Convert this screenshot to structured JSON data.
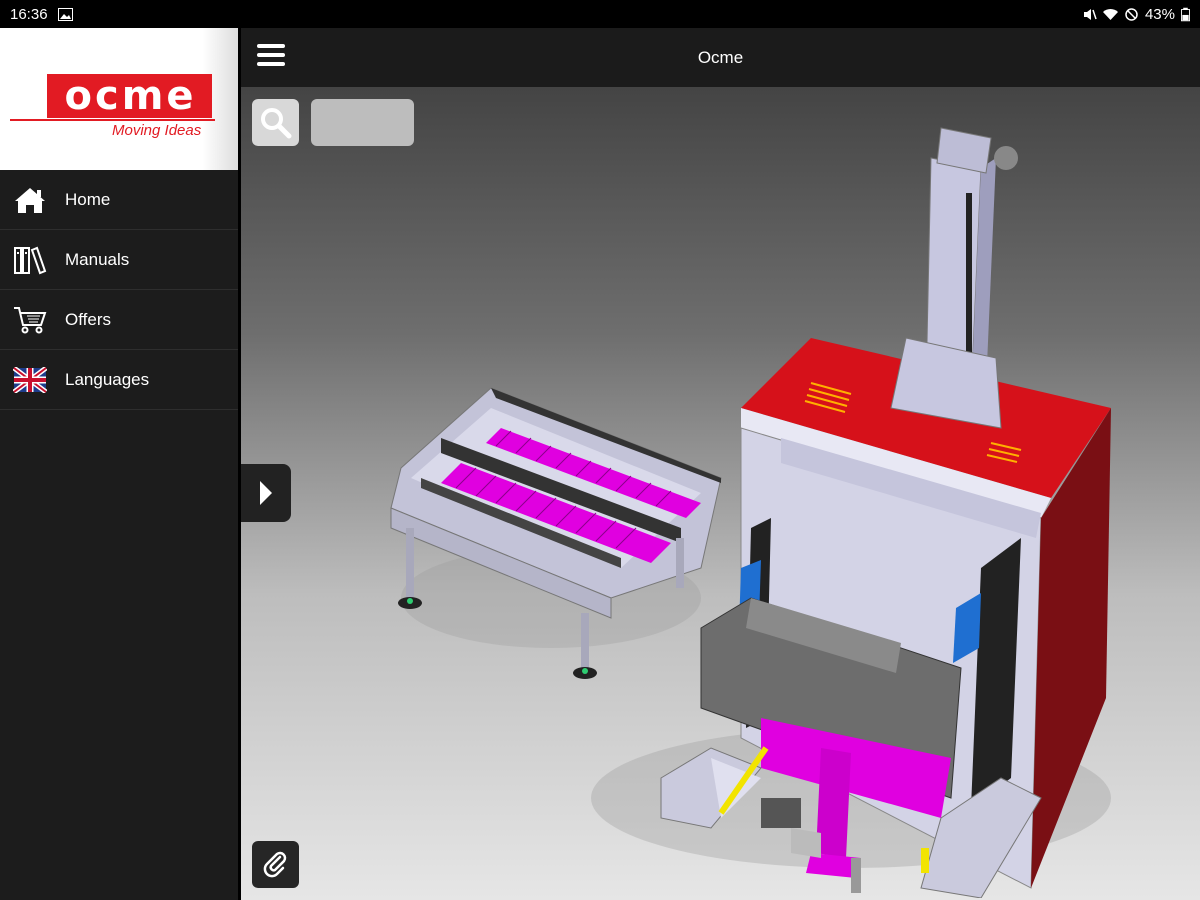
{
  "status_bar": {
    "time": "16:36",
    "battery": "43%"
  },
  "brand": {
    "logo_letters": [
      "o",
      "c",
      "m",
      "e"
    ],
    "tagline": "Moving Ideas",
    "accent_color": "#e21b23"
  },
  "sidebar": {
    "items": [
      {
        "label": "Home",
        "icon": "home-icon"
      },
      {
        "label": "Manuals",
        "icon": "books-icon"
      },
      {
        "label": "Offers",
        "icon": "cart-icon"
      },
      {
        "label": "Languages",
        "icon": "uk-flag-icon"
      }
    ]
  },
  "header": {
    "title": "Ocme"
  },
  "search": {
    "value": "",
    "placeholder": ""
  },
  "icons": {
    "search": "search-icon",
    "menu": "hamburger-icon",
    "expand": "chevron-right-icon",
    "attach": "paperclip-icon"
  }
}
